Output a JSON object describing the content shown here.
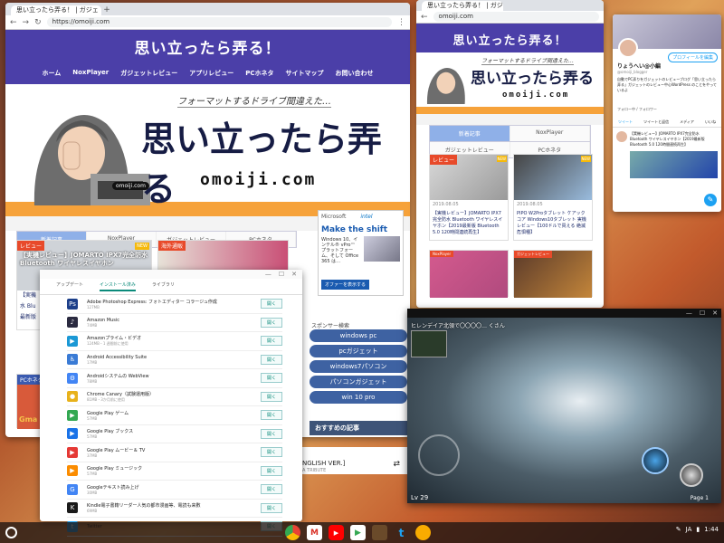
{
  "browser1": {
    "tab_title": "思い立ったら弄る！ | ガジェ",
    "url": "https://omoiji.com"
  },
  "site": {
    "title": "思い立ったら弄る！",
    "nav": [
      "ホーム",
      "NoxPlayer",
      "ガジェットレビュー",
      "アプリレビュー",
      "PCホネタ",
      "サイトマップ",
      "お問い合わせ"
    ],
    "hero_sub": "フォーマットするドライブ間違えた…",
    "hero_big": "思い立ったら弄る",
    "hero_domain": "omoiji.com",
    "cap_label": "omoiji.com",
    "tabs": [
      "新着記事",
      "NoxPlayer",
      "ガジェットレビュー",
      "PCホネタ"
    ],
    "card1": {
      "badge": "レビュー",
      "ribbon": "NEW",
      "text": "【実機レビュー】JOMARTO IPX7完全防水 Bluetooth ワイヤレスイヤホン",
      "partial": [
        "【実機",
        "水 Blu",
        "最新版"
      ],
      "date": "2019.0"
    },
    "card2": {
      "badge": "海外通販"
    },
    "card3": {
      "badge": "PCホネタ",
      "lines": [
        "Gma",
        "Fc"
      ]
    },
    "ad": {
      "brand": "Microsoft",
      "intel": "intel",
      "headline": "Make the shift",
      "body": "Windows 10、インテル® vPro™ プラットフォーム、そして Office 365 は…",
      "cta": "オファーを表示する"
    },
    "sponsor_label": "スポンサー検索",
    "sponsor_pills": [
      "windows pc",
      "pcガジェット",
      "windows7パソコン",
      "パソコンガジェット",
      "win 10 pro"
    ],
    "recommended": "おすすめの記事",
    "english_ver": "NGLISH VER.]",
    "tribute": "A TRIBUTE"
  },
  "browser2": {
    "tab_title": "思い立ったら弄る！ | ガジ",
    "url": "omoiji.com",
    "title": "思い立ったら弄る！",
    "hero_sub": "フォーマットするドライブ間違えた…",
    "hero_big": "思い立ったら弄る",
    "hero_domain": "omoiji.com",
    "tabs_row1": [
      "新着記事",
      "NoxPlayer"
    ],
    "tabs_row2": [
      "ガジェットレビュー",
      "PCホネタ"
    ],
    "cards": [
      {
        "badge": "レビュー",
        "ribbon": "NEW",
        "date": "2019.08.05",
        "text": "【実機レビュー】JOMARTO IPX7完全防水 Bluetooth ワイヤレスイヤホン【2019最新版 Bluetooth 5.0 120時間連続再生】"
      },
      {
        "badge": "",
        "ribbon": "NEW",
        "date": "2019.08.05",
        "text": "PIPO W2Proタブレット ケアックコア Windows10タブレット 実機レビュー【100ドルで買える 絶滅危惧種】"
      },
      {
        "badge": "NoxPlayer",
        "ribbon": "NEW",
        "date": "",
        "text": ""
      },
      {
        "badge": "ガジェットレビュー",
        "ribbon": "NEW",
        "date": "",
        "text": ""
      }
    ]
  },
  "store": {
    "tabs": [
      "アップデート",
      "インストール済み",
      "ライブラリ"
    ],
    "open_label": "開く",
    "apps": [
      {
        "name": "Adobe Photoshop Express: フォトエディター コラージュ作成",
        "meta": "127MB",
        "color": "#1c3f8a",
        "glyph": "Ps"
      },
      {
        "name": "Amazon Music",
        "meta": "74MB",
        "color": "#2a2a40",
        "glyph": "♪"
      },
      {
        "name": "Amazonプライム・ビデオ",
        "meta": "124MB・1 週間前に使用",
        "color": "#1a98d5",
        "glyph": "▶"
      },
      {
        "name": "Android Accessibility Suite",
        "meta": "17MB",
        "color": "#3a7bd5",
        "glyph": "♿"
      },
      {
        "name": "Androidシステムの WebView",
        "meta": "78MB",
        "color": "#4285f4",
        "glyph": "⚙"
      },
      {
        "name": "Chrome Canary（試験運用版）",
        "meta": "81MB・3か月前に使用",
        "color": "#e8b21c",
        "glyph": "●"
      },
      {
        "name": "Google Play ゲーム",
        "meta": "57MB",
        "color": "#33a852",
        "glyph": "▶"
      },
      {
        "name": "Google Play ブックス",
        "meta": "57MB",
        "color": "#1a73e8",
        "glyph": "▶"
      },
      {
        "name": "Google Play ムービー＆ TV",
        "meta": "37MB",
        "color": "#e53935",
        "glyph": "▶"
      },
      {
        "name": "Google Play ミュージック",
        "meta": "57MB",
        "color": "#fb8c00",
        "glyph": "▶"
      },
      {
        "name": "Googleテキスト読み上げ",
        "meta": "30MB",
        "color": "#4285f4",
        "glyph": "G"
      },
      {
        "name": "Kindle電子書籍リーダー人気の都市漫画等、電読も来數",
        "meta": "69MB",
        "color": "#1a1a1a",
        "glyph": "K"
      },
      {
        "name": "Twitter",
        "meta": "",
        "color": "#1da1f2",
        "glyph": "t"
      }
    ]
  },
  "twitter": {
    "profile_btn": "プロフィールを編集",
    "name": "りょうへい@小編",
    "handle": "@omoiji_blogger",
    "bio": "自動でPC弄りをガジェットのレビューブログ「思い立ったら弄る」ガジェットのレビュー中心WordPress のことをやっているよ",
    "tabs": [
      "ツイート",
      "ツイートと返信",
      "メディア",
      "いいね"
    ],
    "follow_info": "フォロー中 / フォロワー",
    "tweet_text": "【実機レビュー】JOMARTO IPX7完全防水 Bluetooth ワイヤレスイヤホン【2019最新版 Bluetooth 5.0 120時間連続再生】"
  },
  "game": {
    "level": "Lv 29",
    "page": "Page 1",
    "banner": "ヒレンデイア北領で〇〇〇〇… くさん"
  },
  "shelf": {
    "ime": "JA",
    "time": "1:44"
  }
}
